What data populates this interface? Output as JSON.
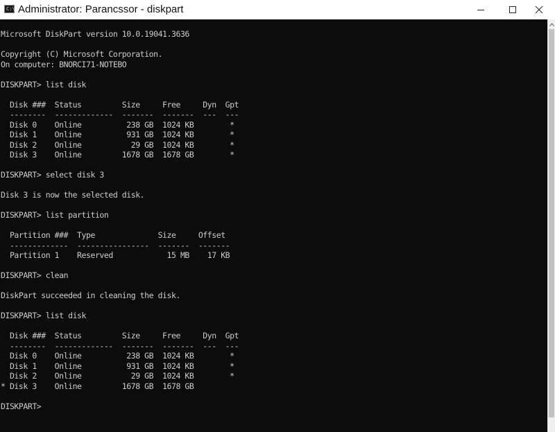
{
  "window": {
    "title": "Administrator: Parancssor - diskpart",
    "icon_label": "C:\\",
    "icons": {
      "app": "console-icon",
      "minimize": "minimize-icon",
      "maximize": "maximize-icon",
      "close": "close-icon"
    }
  },
  "console": {
    "background": "#0c0c0c",
    "foreground": "#cccccc",
    "lines": [
      "Microsoft DiskPart version 10.0.19041.3636",
      "",
      "Copyright (C) Microsoft Corporation.",
      "On computer: BNORCI71-NOTEBO",
      "",
      "DISKPART> list disk",
      "",
      "  Disk ###  Status         Size     Free     Dyn  Gpt",
      "  --------  -------------  -------  -------  ---  ---",
      "  Disk 0    Online          238 GB  1024 KB        *",
      "  Disk 1    Online          931 GB  1024 KB        *",
      "  Disk 2    Online           29 GB  1024 KB        *",
      "  Disk 3    Online         1678 GB  1678 GB        *",
      "",
      "DISKPART> select disk 3",
      "",
      "Disk 3 is now the selected disk.",
      "",
      "DISKPART> list partition",
      "",
      "  Partition ###  Type              Size     Offset",
      "  -------------  ----------------  -------  -------",
      "  Partition 1    Reserved            15 MB    17 KB",
      "",
      "DISKPART> clean",
      "",
      "DiskPart succeeded in cleaning the disk.",
      "",
      "DISKPART> list disk",
      "",
      "  Disk ###  Status         Size     Free     Dyn  Gpt",
      "  --------  -------------  -------  -------  ---  ---",
      "  Disk 0    Online          238 GB  1024 KB        *",
      "  Disk 1    Online          931 GB  1024 KB        *",
      "  Disk 2    Online           29 GB  1024 KB        *",
      "* Disk 3    Online         1678 GB  1678 GB",
      "",
      "DISKPART> "
    ]
  }
}
